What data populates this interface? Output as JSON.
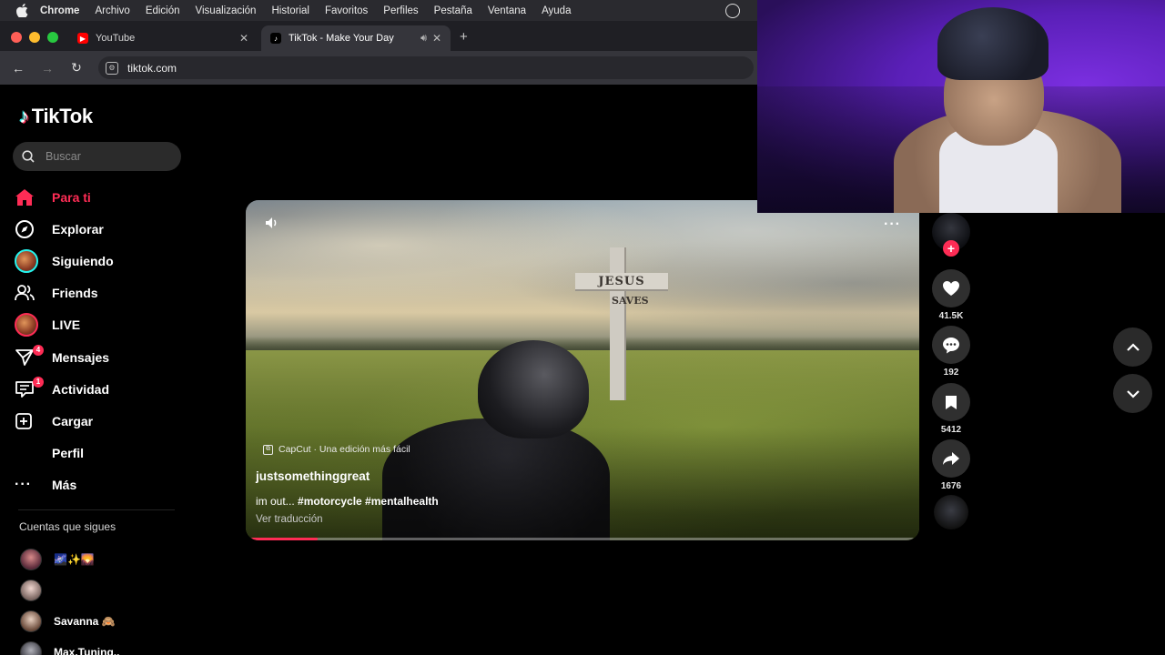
{
  "menubar": {
    "apple": "",
    "items": [
      "Chrome",
      "Archivo",
      "Edición",
      "Visualización",
      "Historial",
      "Favoritos",
      "Perfiles",
      "Pestaña",
      "Ventana",
      "Ayuda"
    ]
  },
  "browser": {
    "tabs": [
      {
        "title": "YouTube",
        "active": false
      },
      {
        "title": "TikTok - Make Your Day",
        "active": true
      }
    ],
    "new_tab": "+",
    "url": "tiktok.com"
  },
  "tiktok": {
    "logo_text": "TikTok",
    "search_placeholder": "Buscar",
    "nav": [
      {
        "label": "Para ti",
        "icon": "home-icon",
        "active": true
      },
      {
        "label": "Explorar",
        "icon": "compass-icon"
      },
      {
        "label": "Siguiendo",
        "icon": "following-avatar-icon"
      },
      {
        "label": "Friends",
        "icon": "friends-icon"
      },
      {
        "label": "LIVE",
        "icon": "live-avatar-icon"
      },
      {
        "label": "Mensajes",
        "icon": "send-icon",
        "badge": "4"
      },
      {
        "label": "Actividad",
        "icon": "inbox-icon",
        "badge": "1"
      },
      {
        "label": "Cargar",
        "icon": "upload-icon"
      },
      {
        "label": "Perfil",
        "icon": ""
      },
      {
        "label": "Más",
        "icon": "more-icon"
      }
    ],
    "following_title": "Cuentas que sigues",
    "following": [
      {
        "name": "🌌✨🌄"
      },
      {
        "name": ""
      },
      {
        "name": "Savanna 🙈"
      },
      {
        "name": "Max.Tuning.."
      }
    ],
    "video": {
      "capcut": "CapCut · Una edición más fácil",
      "author": "justsomethinggreat",
      "desc_prefix": "im out... ",
      "tags": "#motorcycle #mentalhealth",
      "translate": "Ver traducción",
      "sign_top": "JESUS",
      "sign_vertical": "SAVES",
      "progress": 0.1
    },
    "actions": {
      "likes": "41.5K",
      "comments": "192",
      "saves": "5412",
      "shares": "1676"
    }
  },
  "colors": {
    "accent": "#fe2c55",
    "cyan": "#25f4ee",
    "webcam_purple": "#7b2fe0"
  }
}
